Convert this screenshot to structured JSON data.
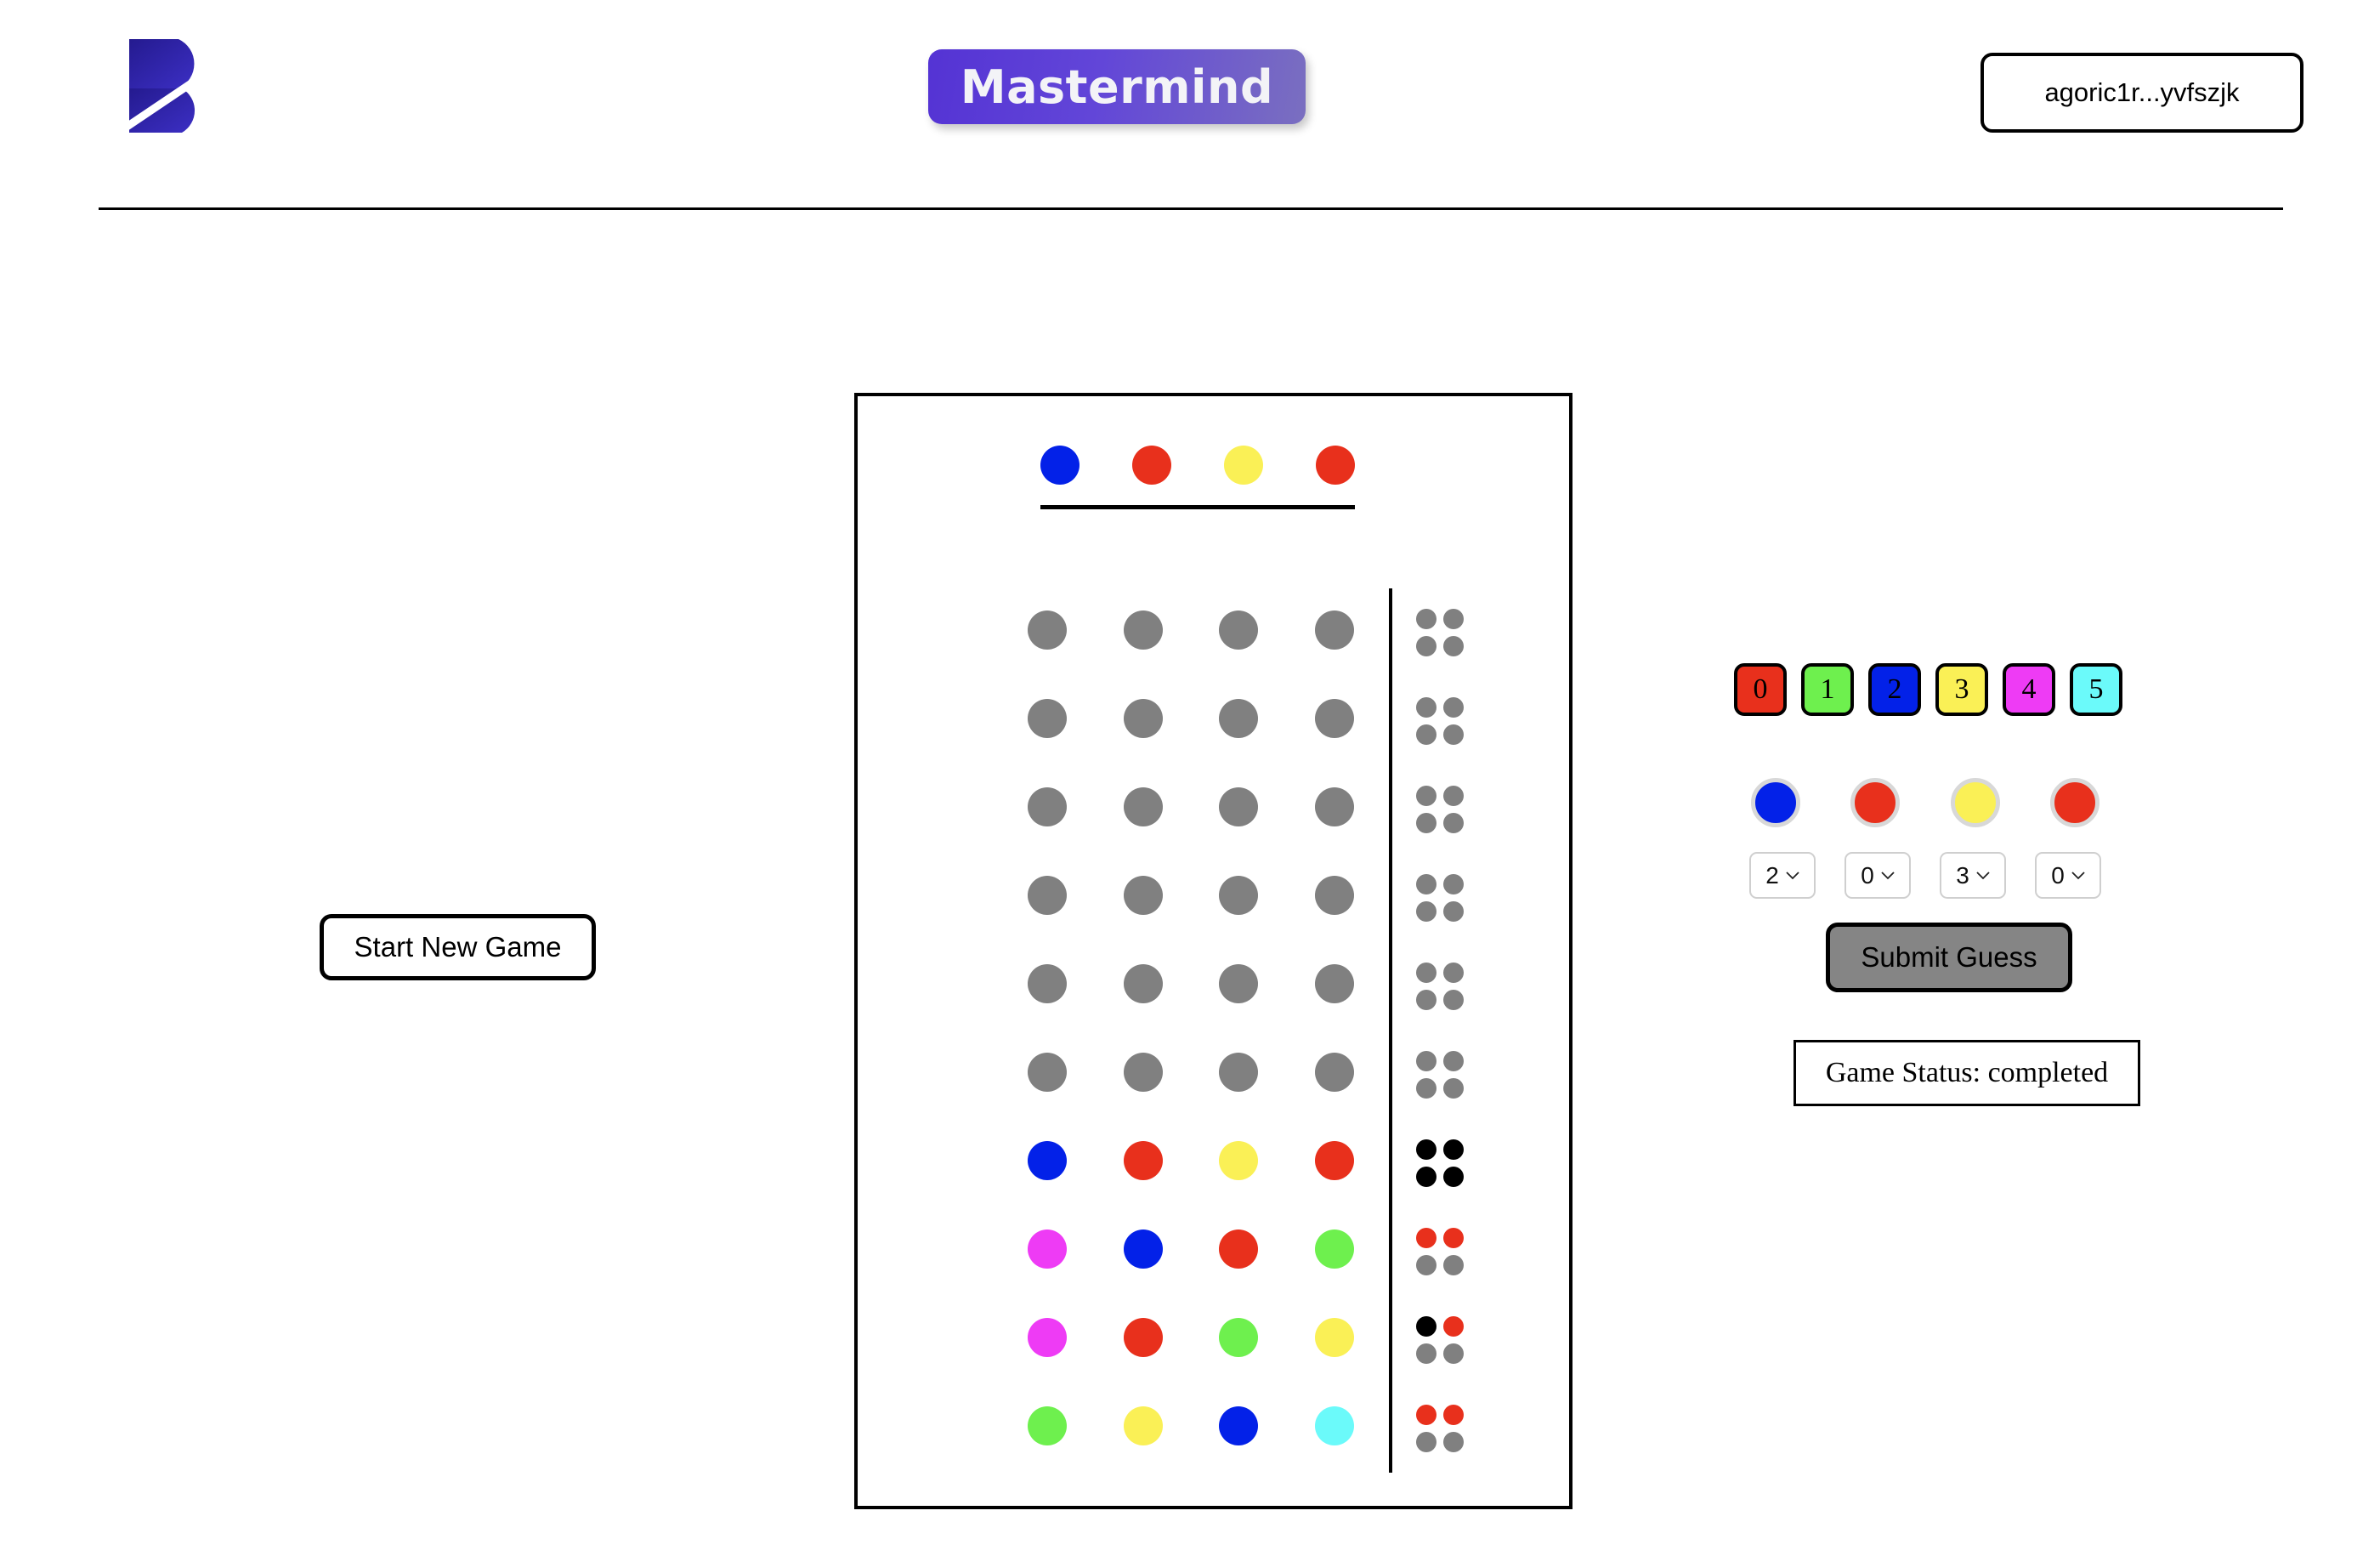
{
  "header": {
    "logo_icon": "brand-b-logo-icon",
    "logo_color": "#2A2099",
    "title": "Mastermind",
    "title_gradient_from": "#5433d4",
    "title_gradient_to": "#7a6fc0",
    "wallet_address": "agoric1r...yvfszjk"
  },
  "left": {
    "start_new_game_label": "Start New Game"
  },
  "palette": {
    "red": "#E8301C",
    "green": "#6EF04E",
    "blue": "#0321E8",
    "yellow": "#FAF056",
    "magenta": "#EE3BF5",
    "cyan": "#6BFAFA",
    "empty": "#808080",
    "exact": "#000000",
    "partial": "#E8301C",
    "none": "#808080"
  },
  "board": {
    "secret_code": [
      "blue",
      "red",
      "yellow",
      "red"
    ],
    "secret_revealed": true,
    "rows": [
      {
        "guess": [
          "empty",
          "empty",
          "empty",
          "empty"
        ],
        "feedback": [
          "none",
          "none",
          "none",
          "none"
        ]
      },
      {
        "guess": [
          "empty",
          "empty",
          "empty",
          "empty"
        ],
        "feedback": [
          "none",
          "none",
          "none",
          "none"
        ]
      },
      {
        "guess": [
          "empty",
          "empty",
          "empty",
          "empty"
        ],
        "feedback": [
          "none",
          "none",
          "none",
          "none"
        ]
      },
      {
        "guess": [
          "empty",
          "empty",
          "empty",
          "empty"
        ],
        "feedback": [
          "none",
          "none",
          "none",
          "none"
        ]
      },
      {
        "guess": [
          "empty",
          "empty",
          "empty",
          "empty"
        ],
        "feedback": [
          "none",
          "none",
          "none",
          "none"
        ]
      },
      {
        "guess": [
          "empty",
          "empty",
          "empty",
          "empty"
        ],
        "feedback": [
          "none",
          "none",
          "none",
          "none"
        ]
      },
      {
        "guess": [
          "blue",
          "red",
          "yellow",
          "red"
        ],
        "feedback": [
          "exact",
          "exact",
          "exact",
          "exact"
        ]
      },
      {
        "guess": [
          "magenta",
          "blue",
          "red",
          "green"
        ],
        "feedback": [
          "partial",
          "partial",
          "none",
          "none"
        ]
      },
      {
        "guess": [
          "magenta",
          "red",
          "green",
          "yellow"
        ],
        "feedback": [
          "exact",
          "partial",
          "none",
          "none"
        ]
      },
      {
        "guess": [
          "green",
          "yellow",
          "blue",
          "cyan"
        ],
        "feedback": [
          "partial",
          "partial",
          "none",
          "none"
        ]
      }
    ]
  },
  "controls": {
    "legend": [
      {
        "value": "0",
        "color": "red"
      },
      {
        "value": "1",
        "color": "green"
      },
      {
        "value": "2",
        "color": "blue"
      },
      {
        "value": "3",
        "color": "yellow"
      },
      {
        "value": "4",
        "color": "magenta"
      },
      {
        "value": "5",
        "color": "cyan"
      }
    ],
    "current_guess_colors": [
      "blue",
      "red",
      "yellow",
      "red"
    ],
    "selectors": [
      {
        "value": "2",
        "options": [
          "0",
          "1",
          "2",
          "3",
          "4",
          "5"
        ]
      },
      {
        "value": "0",
        "options": [
          "0",
          "1",
          "2",
          "3",
          "4",
          "5"
        ]
      },
      {
        "value": "3",
        "options": [
          "0",
          "1",
          "2",
          "3",
          "4",
          "5"
        ]
      },
      {
        "value": "0",
        "options": [
          "0",
          "1",
          "2",
          "3",
          "4",
          "5"
        ]
      }
    ],
    "submit_label": "Submit Guess",
    "submit_disabled": true,
    "status_text": "Game Status: completed",
    "status_value": "completed"
  }
}
